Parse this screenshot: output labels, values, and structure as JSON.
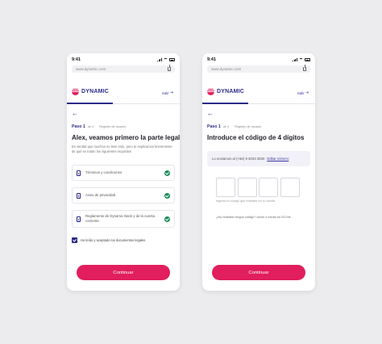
{
  "status_bar": {
    "time": "9:41"
  },
  "browser": {
    "url": "www.dynamic.com"
  },
  "brand": {
    "name": "DYNAMIC",
    "exit_label": "Salir",
    "colors": {
      "primary": "#2c2b88",
      "accent": "#e11e5e",
      "success": "#1a8c5a"
    }
  },
  "left_screen": {
    "back_icon": "arrow-left-icon",
    "step": {
      "number": "Paso 1",
      "of": "de 4",
      "name": "Registro de usuario"
    },
    "title": "Alex, veamos primero la parte legal",
    "subtitle": "Es verdad que muchos no leen esto, pero te explicamos brevemente de qué se tratan los siguientes requisitos",
    "documents": [
      {
        "label": "Términos y condiciones",
        "icon": "document-icon",
        "status_icon": "check-circle-icon"
      },
      {
        "label": "Aviso de privacidad",
        "icon": "document-icon",
        "status_icon": "check-circle-icon"
      },
      {
        "label": "Reglamento de Dynamic Bank y de la cuenta corriente",
        "icon": "document-icon",
        "status_icon": "check-circle-icon"
      }
    ],
    "consent": {
      "label": "He leído y aceptado los documentos legales",
      "checked": true
    },
    "cta": "Continuar"
  },
  "right_screen": {
    "back_icon": "arrow-left-icon",
    "step": {
      "number": "Paso 1",
      "of": "de 4",
      "name": "Registro de usuario"
    },
    "title": "Introduce el código de 4 dígitos",
    "info": {
      "text": "Lo enviamos al (+56) 9 3033 3030",
      "edit_link": "Editar número"
    },
    "code": {
      "digits": [
        "",
        "",
        "",
        ""
      ]
    },
    "helper": "Ingresa el código que recibiste en tu celular",
    "resend": "¿No recibiste ningún código? volver a enviar en 00:24s",
    "cta": "Continuar"
  }
}
